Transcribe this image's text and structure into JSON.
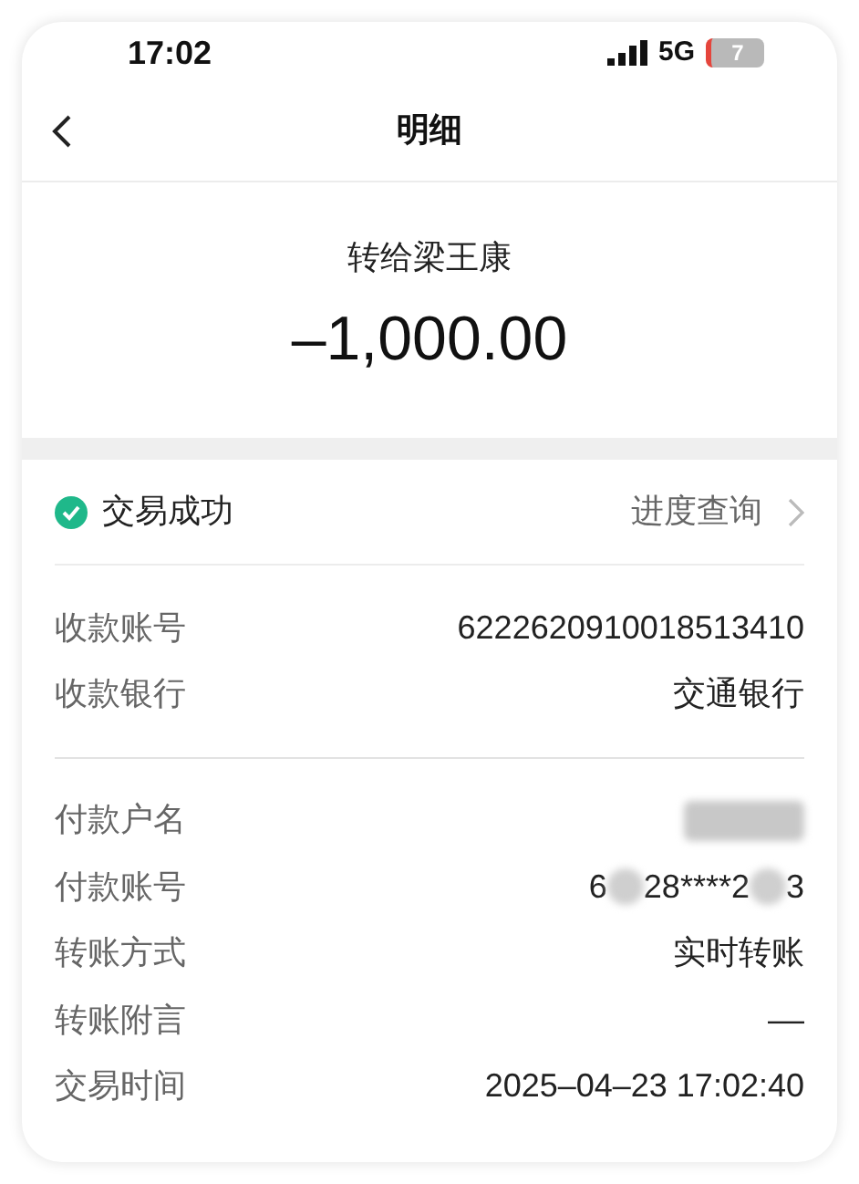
{
  "status_bar": {
    "time": "17:02",
    "network": "5G",
    "battery": "7"
  },
  "nav": {
    "title": "明细"
  },
  "summary": {
    "recipient": "转给梁王康",
    "amount": "–1,000.00"
  },
  "status": {
    "label": "交易成功",
    "success": true,
    "link": "进度查询"
  },
  "groups": [
    {
      "rows": [
        {
          "label": "收款账号",
          "value": [
            "6222620910018513410"
          ]
        },
        {
          "label": "收款银行",
          "value": [
            "交通银行"
          ]
        }
      ]
    },
    {
      "rows": [
        {
          "label": "付款户名",
          "value": [],
          "redacted": true
        },
        {
          "label": "付款账号",
          "value": [
            "6",
            "28****2",
            "3"
          ],
          "redacted": true
        },
        {
          "label": "转账方式",
          "value": [
            "实时转账"
          ]
        },
        {
          "label": "转账附言",
          "value": [
            "––"
          ]
        },
        {
          "label": "交易时间",
          "value": [
            "2025–04–23 17:02:40"
          ]
        }
      ]
    }
  ]
}
